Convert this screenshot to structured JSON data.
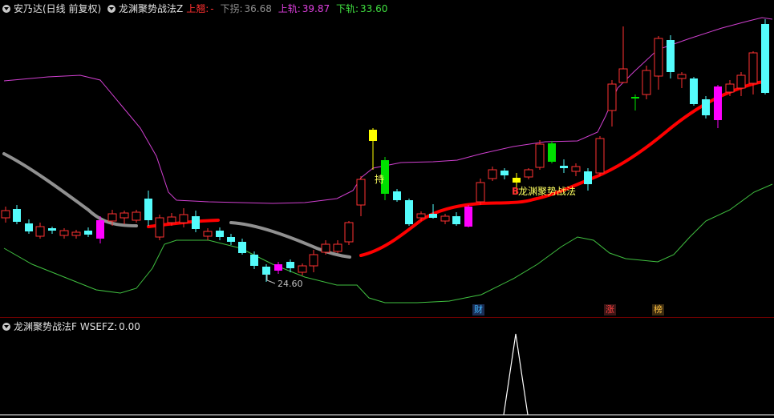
{
  "main_header": {
    "stock": "安乃达(日线 前复权)",
    "indicator": "龙渊聚势战法Z",
    "up_label": "上翘:",
    "up_value": "-",
    "down_label": "下拐:",
    "down_value": "36.68",
    "upper_label": "上轨:",
    "upper_value": "39.87",
    "lower_label": "下轨:",
    "lower_value": "33.60"
  },
  "sub_header": {
    "indicator": "龙渊聚势战法F",
    "series_label": "WSEFZ:",
    "series_value": "0.00"
  },
  "annotations": {
    "hold": "持",
    "strategy_marker": "B",
    "strategy_text": "龙渊聚势战法",
    "low_price": "24.60"
  },
  "event_tags": {
    "cai": "财",
    "zhang": "涨",
    "bang": "榜"
  },
  "colors": {
    "up": "#ff3232",
    "down": "#54fcfc",
    "magenta": "#ff00ff",
    "yellow": "#ffff00",
    "green_bar": "#00e000",
    "upper_band": "#d040d0",
    "lower_band": "#40c040",
    "trend_red": "#ff0000",
    "trend_grey": "#909090"
  }
}
